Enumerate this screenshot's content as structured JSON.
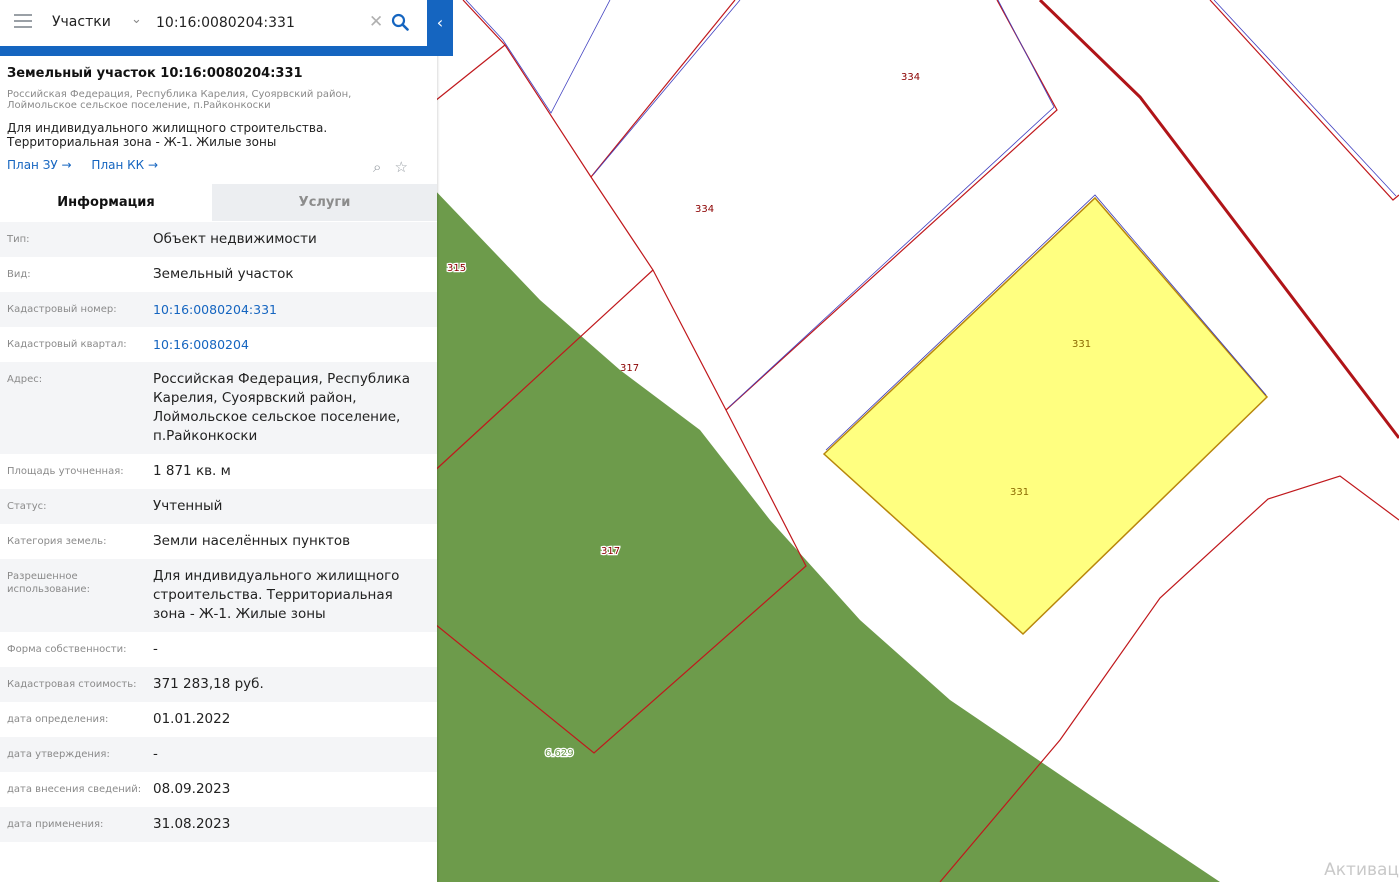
{
  "search": {
    "type_label": "Участки",
    "query": "10:16:0080204:331"
  },
  "card": {
    "title": "Земельный участок 10:16:0080204:331",
    "address": "Российская Федерация, Республика Карелия, Суоярвский район, Лоймольское сельское поселение, п.Райконкоски",
    "use": "Для индивидуального жилищного строительства. Территориальная зона - Ж-1. Жилые зоны",
    "link_plan_zu": "План ЗУ →",
    "link_plan_kk": "План КК →"
  },
  "tabs": {
    "info": "Информация",
    "services": "Услуги"
  },
  "info_rows": [
    {
      "label": "Тип:",
      "value": "Объект недвижимости"
    },
    {
      "label": "Вид:",
      "value": "Земельный участок"
    },
    {
      "label": "Кадастровый номер:",
      "value": "10:16:0080204:331"
    },
    {
      "label": "Кадастровый квартал:",
      "value": "10:16:0080204"
    },
    {
      "label": "Адрес:",
      "value": "Российская Федерация, Республика Карелия, Суоярвский район, Лоймольское сельское поселение, п.Райконкоски"
    },
    {
      "label": "Площадь уточненная:",
      "value": "1 871 кв. м"
    },
    {
      "label": "Статус:",
      "value": "Учтенный"
    },
    {
      "label": "Категория земель:",
      "value": "Земли населённых пунктов"
    },
    {
      "label": "Разрешенное использование:",
      "value": "Для индивидуального жилищного строительства. Территориальная зона - Ж-1. Жилые зоны"
    },
    {
      "label": "Форма собственности:",
      "value": "-"
    },
    {
      "label": "Кадастровая стоимость:",
      "value": "371 283,18 руб."
    },
    {
      "label": "дата определения:",
      "value": "01.01.2022"
    },
    {
      "label": "дата утверждения:",
      "value": "-"
    },
    {
      "label": "дата внесения сведений:",
      "value": "08.09.2023"
    },
    {
      "label": "дата применения:",
      "value": "31.08.2023"
    }
  ],
  "map_labels": {
    "p334a": "334",
    "p334b": "334",
    "p315": "315",
    "p317a": "317",
    "p317b": "317",
    "p331a": "331",
    "p331b": "331",
    "p6629": "6.629"
  },
  "watermark": "Активац",
  "colors": {
    "accent": "#1565c0",
    "boundary": "#c0181c",
    "forest": "#6d9b4b",
    "selected_parcel": "#ffff80"
  }
}
